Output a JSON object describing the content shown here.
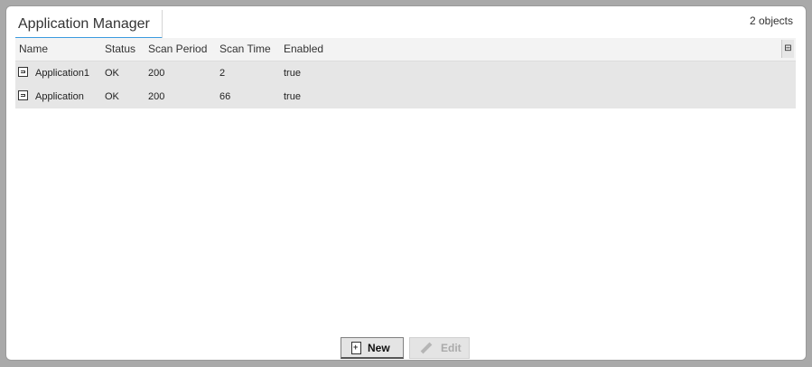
{
  "window": {
    "title": "Application Manager",
    "object_count": "2 objects"
  },
  "table": {
    "columns": [
      "Name",
      "Status",
      "Scan Period",
      "Scan Time",
      "Enabled"
    ],
    "rows": [
      {
        "name": "Application1",
        "status": "OK",
        "scan_period": "200",
        "scan_time": "2",
        "enabled": "true",
        "icon": "application-icon"
      },
      {
        "name": "Application",
        "status": "OK",
        "scan_period": "200",
        "scan_time": "66",
        "enabled": "true",
        "icon": "application-icon"
      }
    ],
    "column_chooser_icon": "column-chooser-icon"
  },
  "actions": {
    "new_label": "New",
    "new_icon": "new-document-icon",
    "edit_label": "Edit",
    "edit_icon": "pencil-icon",
    "edit_enabled": false
  },
  "colors": {
    "accent": "#3c9be0",
    "row_background": "#e6e6e6",
    "page_background": "#a9a9a9"
  }
}
